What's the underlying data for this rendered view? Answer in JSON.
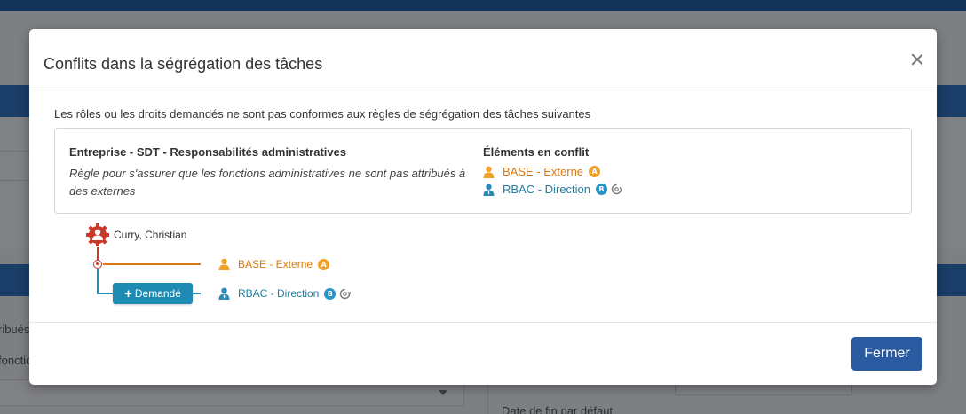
{
  "background": {
    "text1": "ribués",
    "text2": "fonctio",
    "text3": "Date de fin par défaut"
  },
  "modal": {
    "title": "Conflits dans la ségrégation des tâches",
    "intro": "Les rôles ou les droits demandés ne sont pas conformes aux règles de ségrégation des tâches suivantes",
    "rule": {
      "title": "Entreprise - SDT - Responsabilités administratives",
      "description": "Règle pour s'assurer que les fonctions administratives ne sont pas attribués à des externes",
      "conflicts_title": "Éléments en conflit",
      "conflicts": [
        {
          "label": "BASE - Externe",
          "badge": "A",
          "color": "#d97a14"
        },
        {
          "label": "RBAC - Direction",
          "badge": "B",
          "color": "#1f7ea1"
        }
      ]
    },
    "tree": {
      "user": "Curry, Christian",
      "requested_label": "Demandé",
      "items": [
        {
          "label": "BASE - Externe",
          "badge": "A"
        },
        {
          "label": "RBAC - Direction",
          "badge": "B"
        }
      ]
    },
    "close_button": "Fermer"
  },
  "colors": {
    "orange": "#d97a14",
    "blue": "#1f7ea1",
    "red": "#c8392a",
    "primary": "#2a5aa0"
  }
}
